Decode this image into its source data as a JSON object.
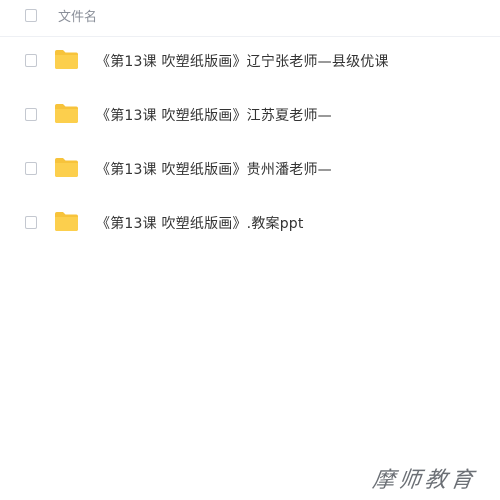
{
  "header": {
    "column_label": "文件名"
  },
  "files": [
    {
      "name": "《第13课 吹塑纸版画》辽宁张老师—县级优课",
      "icon": "folder-icon"
    },
    {
      "name": "《第13课 吹塑纸版画》江苏夏老师—",
      "icon": "folder-icon"
    },
    {
      "name": "《第13课 吹塑纸版画》贵州潘老师—",
      "icon": "folder-icon"
    },
    {
      "name": "《第13课 吹塑纸版画》.教案ppt",
      "icon": "folder-icon"
    }
  ],
  "watermark": "摩师教育",
  "colors": {
    "folder": "#f7c33b",
    "folder_tab": "#f5b921",
    "text": "#333333",
    "header_text": "#8a8f99",
    "checkbox_border": "#c4c8d0"
  }
}
